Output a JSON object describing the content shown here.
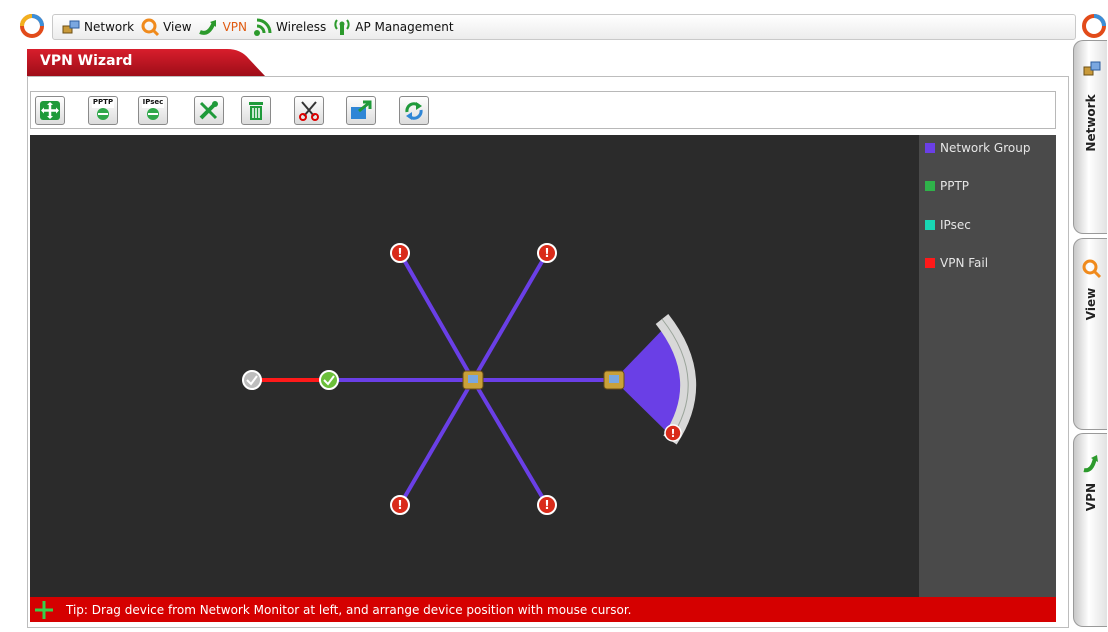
{
  "nav": {
    "items": [
      {
        "label": "Network",
        "icon": "network-icon"
      },
      {
        "label": "View",
        "icon": "view-icon"
      },
      {
        "label": "VPN",
        "icon": "vpn-icon",
        "active": true
      },
      {
        "label": "Wireless",
        "icon": "wireless-icon"
      },
      {
        "label": "AP Management",
        "icon": "ap-management-icon"
      }
    ]
  },
  "page": {
    "title": "VPN Wizard"
  },
  "toolbar": {
    "buttons": [
      {
        "name": "add-button",
        "icon": "plus-arrows-icon"
      },
      {
        "name": "pptp-button",
        "label": "PPTP",
        "icon": "pptp-icon"
      },
      {
        "name": "ipsec-button",
        "label": "IPsec",
        "icon": "ipsec-icon"
      },
      {
        "name": "settings-button",
        "icon": "wrench-screwdriver-icon"
      },
      {
        "name": "delete-button",
        "icon": "trash-icon"
      },
      {
        "name": "cut-button",
        "icon": "scissors-icon"
      },
      {
        "name": "export-button",
        "icon": "export-icon"
      },
      {
        "name": "refresh-button",
        "icon": "refresh-icon"
      }
    ]
  },
  "legend": {
    "items": [
      {
        "label": "Network Group",
        "color": "#6a3fe6"
      },
      {
        "label": "PPTP",
        "color": "#2fb34a"
      },
      {
        "label": "IPsec",
        "color": "#18d6b3"
      },
      {
        "label": "VPN Fail",
        "color": "#ff1a1a"
      }
    ]
  },
  "tip": {
    "text": "Tip: Drag device from Network Monitor at left, and arrange device position with mouse cursor."
  },
  "side_tabs": [
    {
      "label": "Network",
      "icon": "network-icon"
    },
    {
      "label": "View",
      "icon": "view-icon"
    },
    {
      "label": "VPN",
      "icon": "vpn-icon"
    }
  ],
  "colors": {
    "accent": "#c8102e",
    "canvas_bg": "#2b2b2b",
    "legend_bg": "#4a4a4a",
    "link_line": "#6a3fe6",
    "fail_line": "#ff1a1a",
    "status_ok": "#6bbf3a",
    "status_error": "#d92b1a"
  }
}
